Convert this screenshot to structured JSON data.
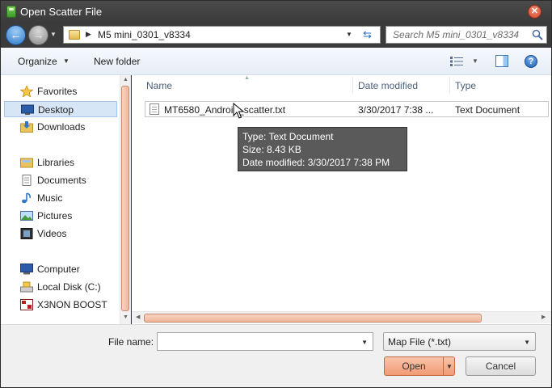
{
  "window": {
    "title": "Open Scatter File",
    "close_glyph": "✕"
  },
  "address_bar": {
    "breadcrumb": "M5 mini_0301_v8334",
    "search_placeholder": "Search M5 mini_0301_v8334"
  },
  "toolbar": {
    "organize_label": "Organize",
    "new_folder_label": "New folder",
    "help_glyph": "?"
  },
  "sidebar": {
    "items": [
      {
        "label": "Favorites",
        "icon": "star-icon"
      },
      {
        "label": "Desktop",
        "icon": "desktop-icon"
      },
      {
        "label": "Downloads",
        "icon": "downloads-icon"
      },
      {
        "label": "Libraries",
        "icon": "libraries-icon"
      },
      {
        "label": "Documents",
        "icon": "documents-icon"
      },
      {
        "label": "Music",
        "icon": "music-icon"
      },
      {
        "label": "Pictures",
        "icon": "pictures-icon"
      },
      {
        "label": "Videos",
        "icon": "videos-icon"
      },
      {
        "label": "Computer",
        "icon": "computer-icon"
      },
      {
        "label": "Local Disk (C:)",
        "icon": "drive-icon"
      },
      {
        "label": "X3NON BOOST",
        "icon": "app-drive-icon"
      }
    ],
    "selected": "Desktop"
  },
  "filelist": {
    "columns": [
      "Name",
      "Date modified",
      "Type"
    ],
    "rows": [
      {
        "name": "MT6580_Android_scatter.txt",
        "date": "3/30/2017 7:38 ...",
        "type": "Text Document"
      }
    ],
    "tooltip": {
      "type_line": "Type: Text Document",
      "size_line": "Size: 8.43 KB",
      "date_line": "Date modified: 3/30/2017 7:38 PM"
    }
  },
  "bottom": {
    "filename_label": "File name:",
    "filename_value": "",
    "filter_value": "Map File (*.txt)",
    "open_label": "Open",
    "cancel_label": "Cancel"
  },
  "colors": {
    "titlebar": "#3b3b3b",
    "accent_button": "#f19b74",
    "scroll_thumb": "#f1b69a",
    "selection": "#d7e6f7"
  }
}
